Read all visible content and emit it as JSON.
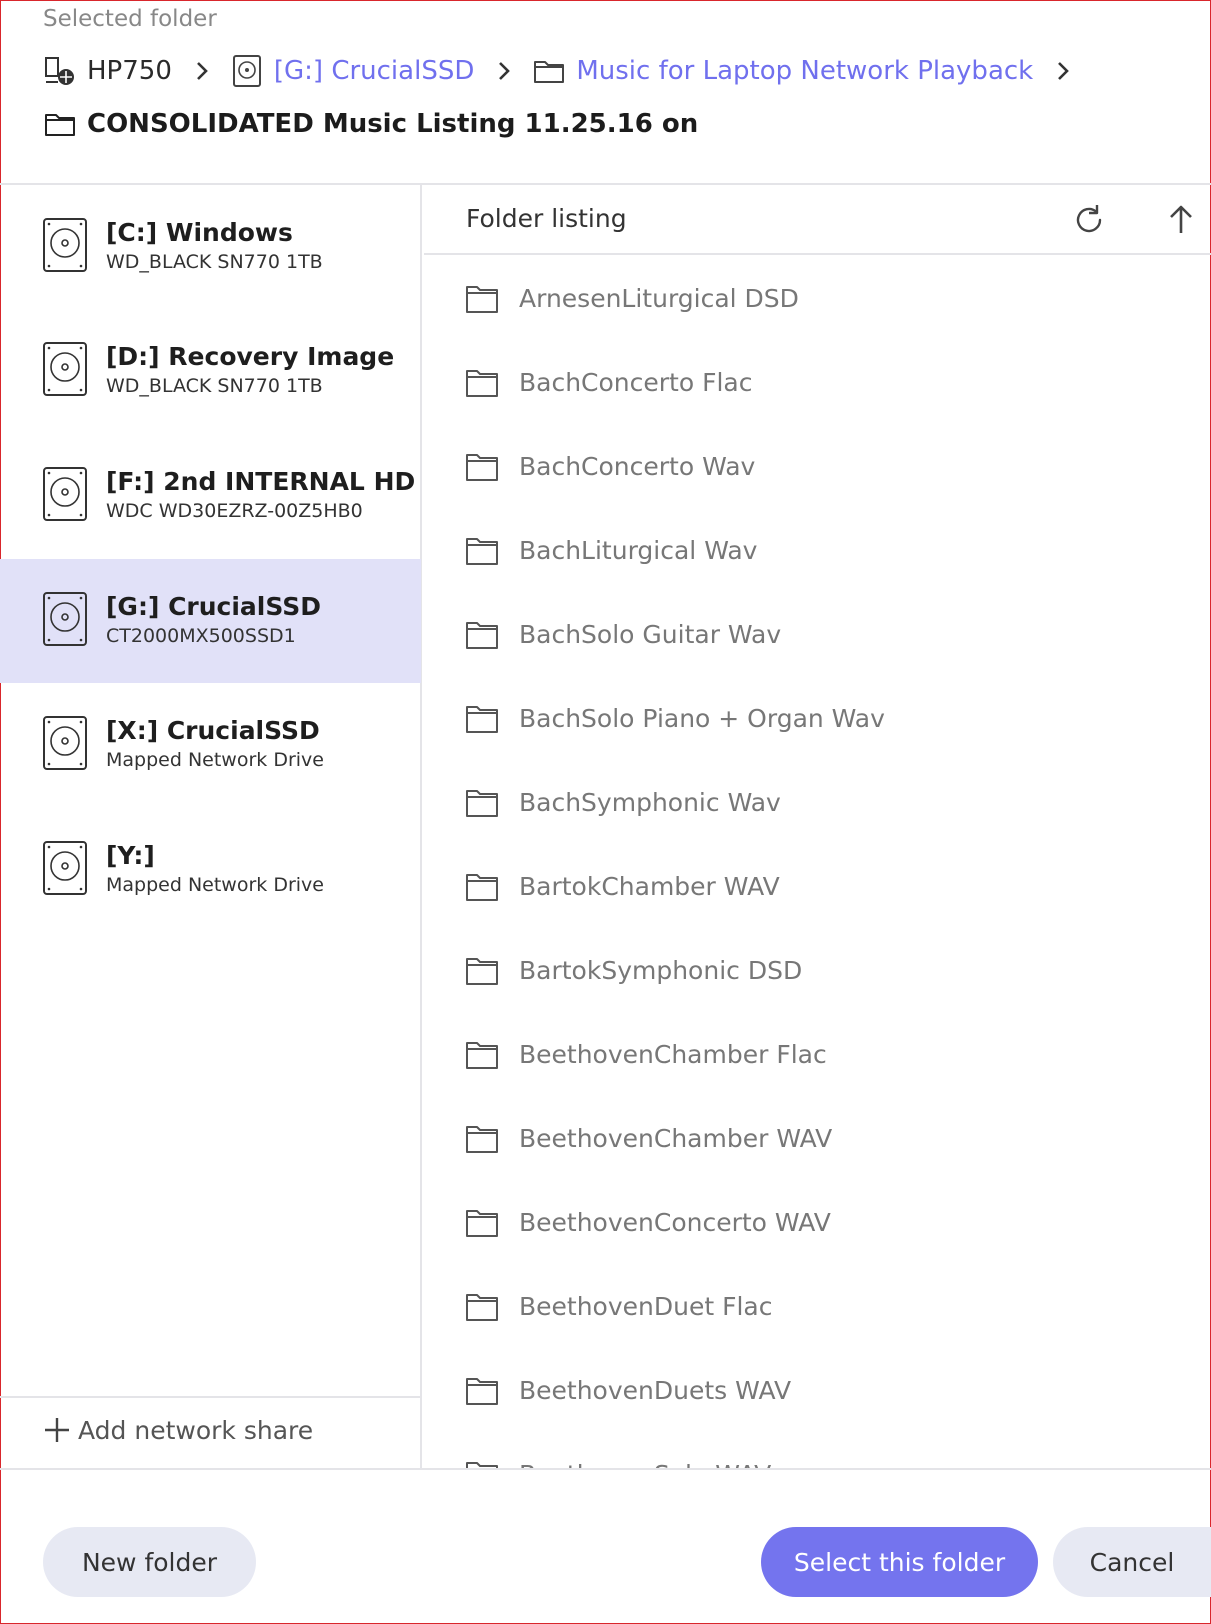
{
  "header": {
    "label": "Selected folder",
    "breadcrumbs": [
      {
        "label": "HP750",
        "icon": "network-computer-icon",
        "style": "plain"
      },
      {
        "label": "[G:] CrucialSSD",
        "icon": "disk-icon",
        "style": "link"
      },
      {
        "label": "Music for Laptop Network Playback",
        "icon": "folder-icon",
        "style": "link"
      },
      {
        "label": "CONSOLIDATED Music Listing 11.25.16 on",
        "icon": "folder-icon",
        "style": "current"
      }
    ]
  },
  "sidebar": {
    "drives": [
      {
        "name": "[C:] Windows",
        "sub": "WD_BLACK SN770 1TB",
        "selected": false
      },
      {
        "name": "[D:] Recovery Image",
        "sub": "WD_BLACK SN770 1TB",
        "selected": false
      },
      {
        "name": "[F:] 2nd INTERNAL HD",
        "sub": "WDC WD30EZRZ-00Z5HB0",
        "selected": false
      },
      {
        "name": "[G:] CrucialSSD",
        "sub": "CT2000MX500SSD1",
        "selected": true
      },
      {
        "name": "[X:] CrucialSSD",
        "sub": "Mapped Network Drive",
        "selected": false
      },
      {
        "name": "[Y:]",
        "sub": "Mapped Network Drive",
        "selected": false
      }
    ],
    "add_share_label": "Add network share"
  },
  "listing": {
    "title": "Folder listing",
    "refresh_icon": "refresh-icon",
    "up_icon": "arrow-up-icon",
    "folders": [
      "ArnesenLiturgical DSD",
      "BachConcerto Flac",
      "BachConcerto Wav",
      "BachLiturgical Wav",
      "BachSolo Guitar Wav",
      "BachSolo Piano + Organ Wav",
      "BachSymphonic Wav",
      "BartokChamber WAV",
      "BartokSymphonic DSD",
      "BeethovenChamber Flac",
      "BeethovenChamber WAV",
      "BeethovenConcerto WAV",
      "BeethovenDuet Flac",
      "BeethovenDuets WAV",
      "BeethovenSolo WAV"
    ]
  },
  "footer": {
    "new_folder_label": "New folder",
    "select_label": "Select this folder",
    "cancel_label": "Cancel"
  },
  "colors": {
    "accent": "#7474ee",
    "selected_bg": "#e1e1f8",
    "secondary_btn_bg": "#e7e9f3",
    "frame_border": "#d9262c"
  }
}
